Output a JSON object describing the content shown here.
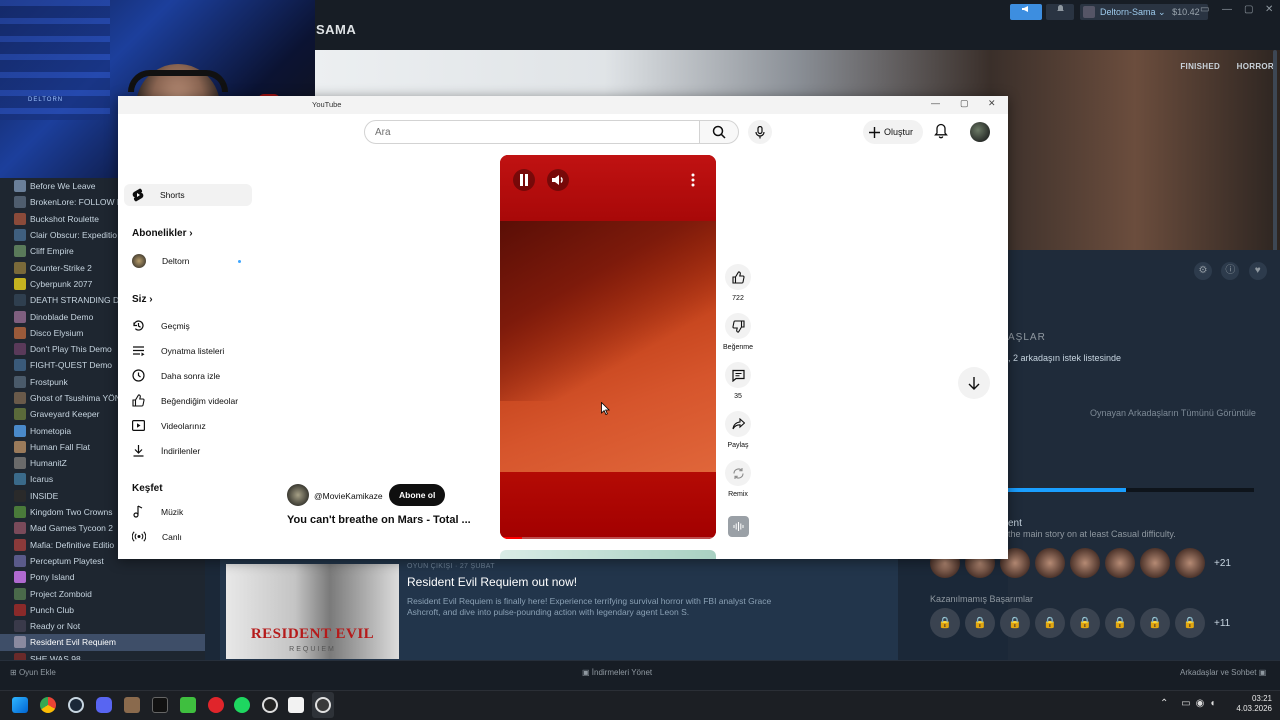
{
  "steam": {
    "game_title": "SAMA",
    "user": {
      "name": "Deltorn-Sama",
      "balance": "$10.42"
    },
    "hero_tags": [
      "FINISHED",
      "HORROR"
    ],
    "friends": {
      "heading": "AŞLAR",
      "text": ", 2 arkadaşın istek listesinde",
      "view_all": "Oynayan Arkadaşların Tümünü Görüntüle"
    },
    "achievements": {
      "progress_fraction": 0.48,
      "title": "ent",
      "desc": "the main story on at least Casual difficulty.",
      "unlocked_more": "+21",
      "locked_heading": "Kazanılmamış Başarımlar",
      "locked_more": "+11"
    },
    "sidebar_games": [
      "Before We Leave",
      "BrokenLore: FOLLOW D",
      "Buckshot Roulette",
      "Clair Obscur: Expeditio",
      "Cliff Empire",
      "Counter-Strike 2",
      "Cyberpunk 2077",
      "DEATH STRANDING DI",
      "Dinoblade Demo",
      "Disco Elysium",
      "Don't Play This Demo",
      "FIGHT-QUEST Demo",
      "Frostpunk",
      "Ghost of Tsushima YÖN",
      "Graveyard Keeper",
      "Hometopia",
      "Human Fall Flat",
      "HumanitZ",
      "Icarus",
      "INSIDE",
      "Kingdom Two Crowns",
      "Mad Games Tycoon 2",
      "Mafia: Definitive Editio",
      "Perceptum Playtest",
      "Pony Island",
      "Project Zomboid",
      "Punch Club",
      "Ready or Not",
      "Resident Evil Requiem",
      "SHE WAS 98"
    ],
    "selected_game_index": 28,
    "news": {
      "meta": "OYUN ÇIKIŞI · 27 ŞUBAT",
      "title": "Resident Evil Requiem out now!",
      "body": "Resident Evil Requiem is finally here! Experience terrifying survival horror with FBI analyst Grace Ashcroft, and dive into pulse-pounding action with legendary agent Leon S.",
      "thumb_title": "RESIDENT EVIL",
      "thumb_sub": "REQUIEM"
    },
    "bottom": {
      "add_game": "Oyun Ekle",
      "downloads": "İndirmeleri Yönet",
      "friends_chat": "Arkadaşlar ve Sohbet"
    }
  },
  "webcam": {
    "sign": "DELTORN"
  },
  "youtube": {
    "window_title": "YouTube",
    "search_placeholder": "Ara",
    "create_label": "Oluştur",
    "guide": {
      "shorts": "Shorts",
      "subscriptions_heading": "Abonelikler",
      "subscription_channel": "Deltorn",
      "you_heading": "Siz",
      "you_items": [
        "Geçmiş",
        "Oynatma listeleri",
        "Daha sonra izle",
        "Beğendiğim videolar",
        "Videolarınız",
        "İndirilenler"
      ],
      "explore_heading": "Keşfet",
      "explore_items": [
        "Müzik",
        "Canlı"
      ]
    },
    "short": {
      "channel": "@MovieKamikaze",
      "subscribe": "Abone ol",
      "title": "You can't breathe on Mars - Total ...",
      "progress_fraction": 0.1,
      "like_count": "722",
      "dislike_label": "Beğenme",
      "comment_count": "35",
      "share_label": "Paylaş",
      "remix_label": "Remix"
    }
  },
  "taskbar": {
    "time": "03:21",
    "date": "4.03.2026"
  }
}
